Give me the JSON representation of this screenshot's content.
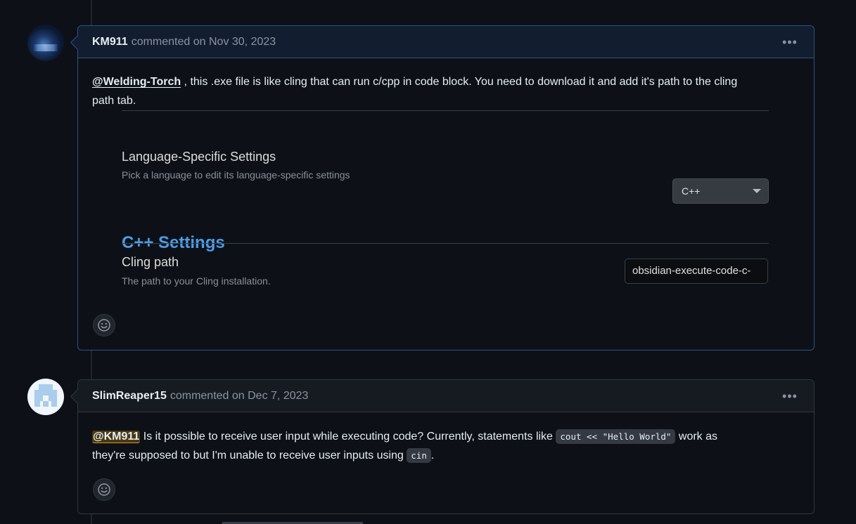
{
  "comments": [
    {
      "author": "KM911",
      "meta": "commented on Nov 30, 2023",
      "body": {
        "mention": "@Welding-Torch",
        "line1": " , this .exe file is like cling that can run c/cpp in code block. You need to download it and add it's path to the cling",
        "line2": "path tab."
      },
      "embedded_settings": {
        "language_title": "Language-Specific Settings",
        "language_desc": "Pick a language to edit its language-specific settings",
        "language_value": "C++",
        "section_heading": "C++ Settings",
        "cling_title": "Cling path",
        "cling_desc": "The path to your Cling installation.",
        "cling_value": "obsidian-execute-code-c-"
      },
      "menu_label": "•••"
    },
    {
      "author": "SlimReaper15",
      "meta": "commented on Dec 7, 2023",
      "body": {
        "mention": "@KM911",
        "text1": " Is it possible to receive user input while executing code? Currently, statements like ",
        "code1": "cout << \"Hello World\"",
        "text2": " work as",
        "text3": "they're supposed to but I'm unable to receive user inputs using ",
        "code2": "cin",
        "text4": "."
      },
      "menu_label": "•••"
    }
  ],
  "icons": {
    "emoji": "smiley-icon",
    "menu": "kebab-horizontal-icon"
  },
  "colors": {
    "background": "#0d1117",
    "highlight_border": "#2f4f86",
    "heading_blue": "#4c9ce8",
    "mention_highlight": "#d29922"
  }
}
